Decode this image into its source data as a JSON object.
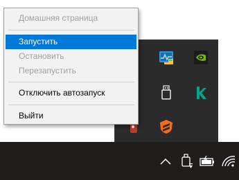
{
  "context_menu": {
    "items": [
      {
        "label": "Домашняя страница",
        "enabled": false
      },
      {
        "label": "Запустить",
        "enabled": true,
        "highlighted": true
      },
      {
        "label": "Остановить",
        "enabled": false
      },
      {
        "label": "Перезапустить",
        "enabled": false
      },
      {
        "label": "Отключить автозапуск",
        "enabled": true
      },
      {
        "label": "Выйти",
        "enabled": true
      }
    ]
  },
  "tray_flyout": {
    "icons": [
      "task-manager-icon",
      "nvidia-icon",
      "usb-drive-icon",
      "kaspersky-icon",
      "red-app-icon",
      "avast-icon"
    ]
  },
  "taskbar": {
    "icons": [
      "chevron-up-icon",
      "usb-eject-icon",
      "battery-icon",
      "wifi-icon"
    ]
  },
  "colors": {
    "taskbar_bg": "#201d1d",
    "flyout_bg": "#2b2b2b",
    "menu_bg": "#f2f2f2",
    "highlight": "#0078d7",
    "disabled_text": "#a0a0a0",
    "nvidia_green": "#76b900",
    "kaspersky_green": "#00a88e",
    "avast_orange": "#f96b16"
  }
}
